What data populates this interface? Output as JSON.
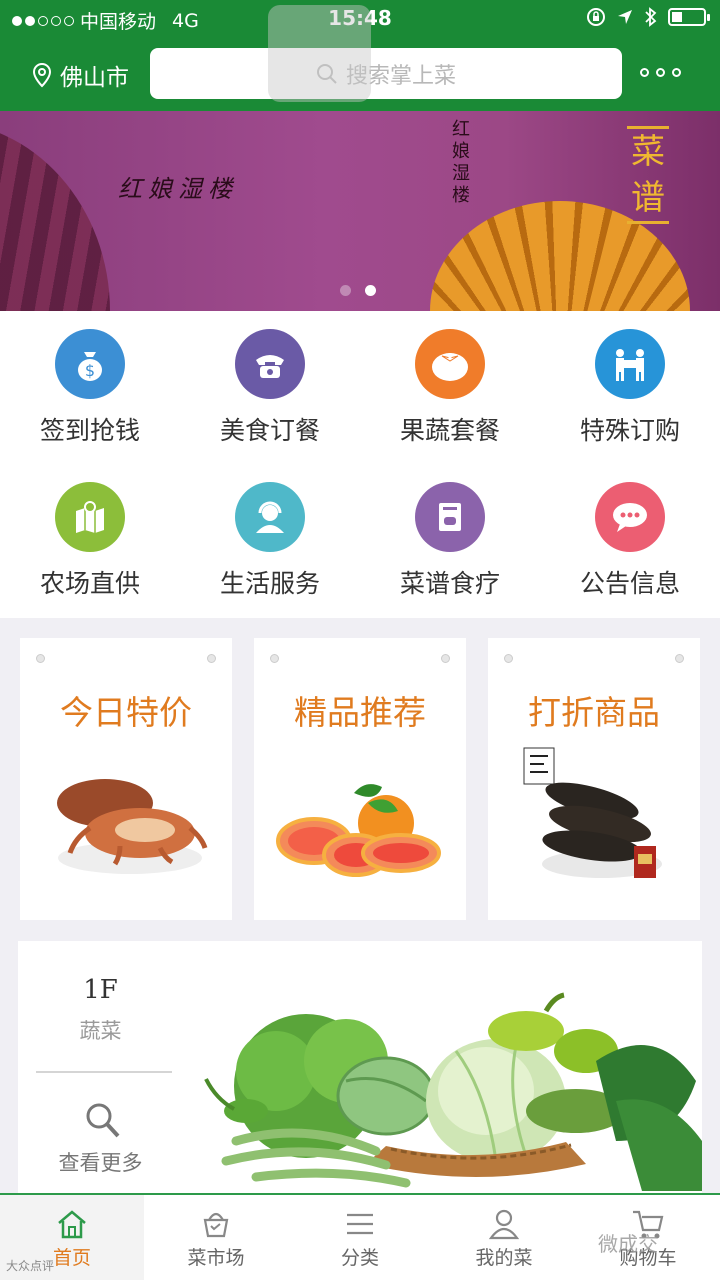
{
  "status_bar": {
    "carrier": "中国移动",
    "network": "4G",
    "time": "15:48"
  },
  "header": {
    "city": "佛山市",
    "search_placeholder": "搜索掌上菜"
  },
  "banner": {
    "text_left": "红娘湿楼",
    "text_vertical": "红娘湿楼",
    "title": "菜谱",
    "slide_count": 2,
    "active_slide": 2
  },
  "quick_menu": [
    {
      "label": "签到抢钱",
      "icon": "money-bag-icon",
      "color": "#3c8fd4"
    },
    {
      "label": "美食订餐",
      "icon": "telephone-icon",
      "color": "#6a5aa6"
    },
    {
      "label": "果蔬套餐",
      "icon": "tomato-icon",
      "color": "#f07c2a"
    },
    {
      "label": "特殊订购",
      "icon": "handshake-icon",
      "color": "#2794d8"
    },
    {
      "label": "农场直供",
      "icon": "map-pin-icon",
      "color": "#8cbe3a"
    },
    {
      "label": "生活服务",
      "icon": "customer-service-icon",
      "color": "#4fb8c9"
    },
    {
      "label": "菜谱食疗",
      "icon": "recipe-book-icon",
      "color": "#8b63ab"
    },
    {
      "label": "公告信息",
      "icon": "chat-bubble-icon",
      "color": "#ec5e72"
    }
  ],
  "promo_cards": [
    {
      "title": "今日特价",
      "image": "crab"
    },
    {
      "title": "精品推荐",
      "image": "grapefruit"
    },
    {
      "title": "打折商品",
      "image": "sea-cucumber"
    }
  ],
  "floor": {
    "number": "1F",
    "name": "蔬菜",
    "more_label": "查看更多"
  },
  "tab_bar": [
    {
      "label": "首页",
      "icon": "home-icon",
      "active": true
    },
    {
      "label": "菜市场",
      "icon": "market-basket-icon",
      "active": false
    },
    {
      "label": "分类",
      "icon": "list-icon",
      "active": false
    },
    {
      "label": "我的菜",
      "icon": "user-icon",
      "active": false
    },
    {
      "label": "购物车",
      "icon": "cart-icon",
      "active": false
    }
  ],
  "watermark": {
    "text": "微成交",
    "corner_text": "大众点评"
  }
}
